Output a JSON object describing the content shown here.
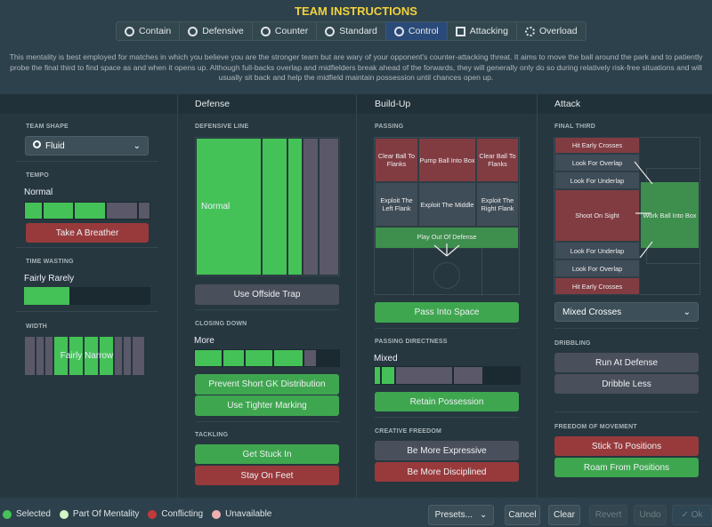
{
  "title": "TEAM INSTRUCTIONS",
  "tabs": [
    {
      "label": "Contain",
      "icon": "contain-icon"
    },
    {
      "label": "Defensive",
      "icon": "shield-icon"
    },
    {
      "label": "Counter",
      "icon": "counter-icon"
    },
    {
      "label": "Standard",
      "icon": "standard-icon"
    },
    {
      "label": "Control",
      "icon": "control-icon",
      "selected": true
    },
    {
      "label": "Attacking",
      "icon": "attacking-icon"
    },
    {
      "label": "Overload",
      "icon": "overload-icon"
    }
  ],
  "description": "This mentality is best employed for matches in which you believe you are the stronger team but are wary of your opponent's counter-attacking threat. It aims to move the ball around the park and to patiently probe the final third to find space as and when it opens up. Although full-backs overlap and midfielders break ahead of the forwards, they will generally only do so during relatively risk-free situations and will usually sit back and help the midfield maintain possession until chances open up.",
  "columns": {
    "defense": "Defense",
    "buildup": "Build-Up",
    "attack": "Attack"
  },
  "left": {
    "team_shape_label": "TEAM SHAPE",
    "team_shape": "Fluid",
    "tempo_label": "TEMPO",
    "tempo": "Normal",
    "tempo_level": 0.55,
    "take_a_breather": "Take A Breather",
    "time_wasting_label": "TIME WASTING",
    "time_wasting": "Fairly Rarely",
    "time_wasting_level": 0.35,
    "width_label": "WIDTH",
    "width": "Fairly Narrow"
  },
  "defense": {
    "line_label": "DEFENSIVE LINE",
    "line": "Normal",
    "offside": "Use Offside Trap",
    "closing_label": "CLOSING DOWN",
    "closing": "More",
    "closing_level": 0.75,
    "prevent_gk": "Prevent Short GK Distribution",
    "tighter": "Use Tighter Marking",
    "tackling_label": "TACKLING",
    "stuck_in": "Get Stuck In",
    "stay_feet": "Stay On Feet"
  },
  "buildup": {
    "passing_label": "PASSING",
    "cells": [
      "Clear Ball To Flanks",
      "Pump Ball Into Box",
      "Clear Ball To Flanks",
      "Exploit The Left Flank",
      "Exploit The Middle",
      "Exploit The Right Flank"
    ],
    "play_out": "Play Out Of Defense",
    "pass_space": "Pass Into Space",
    "directness_label": "PASSING DIRECTNESS",
    "directness": "Mixed",
    "directness_level": 0.13,
    "retain": "Retain Possession",
    "creative_label": "CREATIVE FREEDOM",
    "expressive": "Be More Expressive",
    "disciplined": "Be More Disciplined"
  },
  "attack": {
    "final_third_label": "FINAL THIRD",
    "cells": [
      "Hit Early Crosses",
      "Look For Overlap",
      "Look For Underlap",
      "Shoot On Sight",
      "Look For Underlap",
      "Look For Overlap",
      "Hit Early Crosses"
    ],
    "work_ball": "Work Ball Into Box",
    "crosses": "Mixed Crosses",
    "dribbling_label": "DRIBBLING",
    "run_at": "Run At Defense",
    "dribble_less": "Dribble Less",
    "freedom_label": "FREEDOM OF MOVEMENT",
    "stick": "Stick To Positions",
    "roam": "Roam From Positions"
  },
  "legend": [
    {
      "label": "Selected",
      "color": "#45c257"
    },
    {
      "label": "Part Of Mentality",
      "color": "#d4f5c4"
    },
    {
      "label": "Conflicting",
      "color": "#c23a3a"
    },
    {
      "label": "Unavailable",
      "color": "#f0b0b0"
    }
  ],
  "footer": {
    "presets": "Presets...",
    "cancel": "Cancel",
    "clear": "Clear",
    "revert": "Revert",
    "undo": "Undo",
    "ok": "✓ Ok"
  }
}
